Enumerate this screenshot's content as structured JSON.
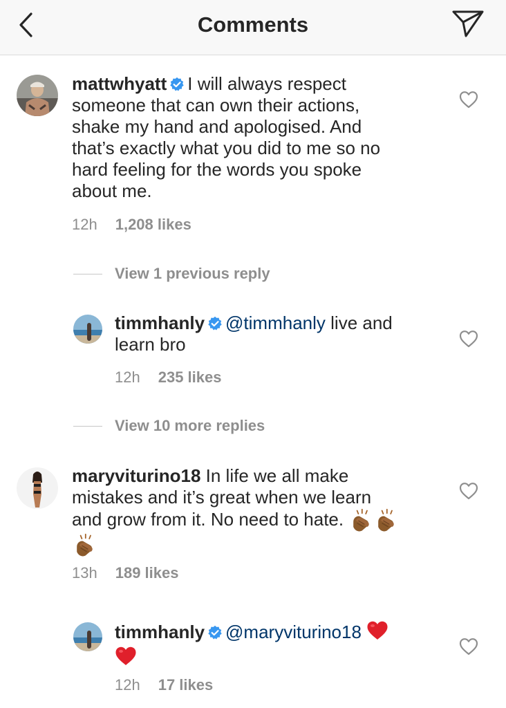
{
  "header": {
    "title": "Comments",
    "back_icon": "chevron-left-icon",
    "send_icon": "paper-plane-icon"
  },
  "comments": [
    {
      "username": "mattwhyatt",
      "verified": true,
      "text": "I will always respect someone that can own their actions, shake my hand and apologised. And that’s exactly what you did to me so no hard feeling for the words you spoke about me.",
      "line1": "I will always respect",
      "lines": [
        "someone that can own their actions,",
        "shake my hand and apologised. And",
        "that’s exactly what you did to me so no",
        "hard feeling for the words you spoke",
        "about me."
      ],
      "time": "12h",
      "likes": "1,208 likes"
    },
    {
      "username": "timmhanly",
      "verified": true,
      "mention": "@timmhanly",
      "line1": "live and",
      "lines": [
        "learn bro"
      ],
      "time": "12h",
      "likes": "235 likes"
    },
    {
      "username": "maryviturino18",
      "verified": false,
      "line1": "In life we all make",
      "lines": [
        "mistakes and it’s great when we learn",
        "and grow from it. No need to hate."
      ],
      "emojis": [
        "clapping-hands-emoji",
        "clapping-hands-emoji",
        "clapping-hands-emoji"
      ],
      "time": "13h",
      "likes": "189 likes"
    },
    {
      "username": "timmhanly",
      "verified": true,
      "mention": "@maryviturino18",
      "emojis": [
        "red-heart-emoji",
        "red-heart-emoji"
      ],
      "time": "12h",
      "likes": "17 likes"
    }
  ],
  "view_previous": "View 1 previous reply",
  "view_more": "View 10 more replies",
  "colors": {
    "verified": "#3897f0",
    "mention": "#003569",
    "meta": "#8e8e8e",
    "heart_emoji": "#e0202b"
  }
}
